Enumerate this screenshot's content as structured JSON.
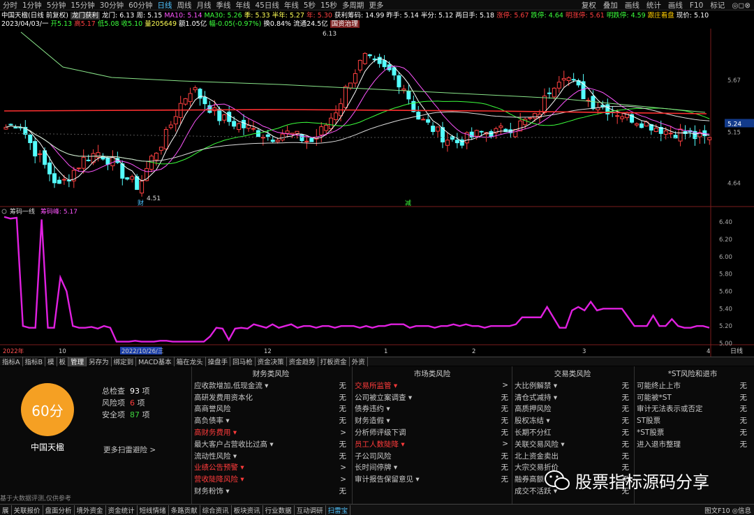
{
  "periods": [
    "分时",
    "1分钟",
    "5分钟",
    "15分钟",
    "30分钟",
    "60分钟",
    "日线",
    "周线",
    "月线",
    "季线",
    "年线",
    "45日线",
    "年线",
    "5秒",
    "15秒",
    "多周期",
    "更多"
  ],
  "active_period_index": 6,
  "top_buttons": [
    "复权",
    "叠加",
    "画线",
    "统计",
    "画线",
    "F10",
    "标记"
  ],
  "top_right_icons": "◎◻⊗",
  "info1": {
    "name": "中国天楹(日线 前复权)",
    "tag": "龙门获利",
    "longmen": "龙门: 6.13",
    "zhou": "周: 5.15",
    "ma10": "MA10: 5.14",
    "ma30": "MA30: 5.26",
    "ji": "季: 5.33",
    "bannian": "半年: 5.27",
    "nian": "年: 5.30",
    "huoli": "获利筹码: 14.99",
    "zuoshou": "昨手: 5.14",
    "banfen": "半分: 5.12",
    "liangri": "两日手: 5.18",
    "zhangting": "涨停: 5.67",
    "dieting": "跌停: 4.64",
    "mingzhang": "明涨停: 5.61",
    "mingdie": "明跌停: 4.59",
    "genzhuang": "跟庄看盘",
    "xianjia": "现价: 5.10"
  },
  "info2": {
    "date": "2023/04/03/一",
    "kai": "开5.13",
    "gao": "高5.17",
    "di": "低5.08",
    "shou": "收5.10",
    "liang": "量205649",
    "e": "额1.05亿",
    "fu": "幅-0.05(-0.97%)",
    "huan": "换0.84%",
    "liutong": "流通24.5亿",
    "badge": "国资治理"
  },
  "price_labels": {
    "high": "6.13",
    "low": "4.51",
    "tag_cai": "财",
    "tag_jian": "减",
    "current": "5.24"
  },
  "price_axis": [
    "5.67",
    "5.15",
    "4.64"
  ],
  "x_axis": [
    "2022年",
    "10",
    "2022/10/26/三",
    "12",
    "1",
    "2",
    "3",
    "4"
  ],
  "sub_header": {
    "name": "筹码一线",
    "value": "筹码峰: 5.17"
  },
  "sub_axis": [
    "6.40",
    "6.20",
    "6.00",
    "5.80",
    "5.60",
    "5.40",
    "5.20",
    "5.00"
  ],
  "corner_label": "日线",
  "chart_data": {
    "type": "line",
    "title": "筹码一线",
    "series": [
      {
        "name": "筹码峰",
        "values": [
          6.46,
          6.44,
          6.45,
          5.2,
          5.18,
          5.18,
          6.43,
          5.18,
          5.18,
          5.76,
          5.6,
          5.2,
          5.18,
          5.18,
          5.19,
          5.17,
          5.2,
          5.18,
          5.02,
          5.02,
          5.02,
          5.03,
          5.02,
          5.02,
          5.02,
          5.03,
          5.03,
          5.02,
          5.02,
          5.02,
          5.02,
          5.02,
          5.02,
          5.08,
          5.18,
          5.17,
          5.04,
          5.17,
          5.18,
          5.17,
          5.22,
          5.2,
          5.18,
          5.22,
          5.18,
          5.2,
          5.22,
          5.18,
          5.2,
          5.2,
          5.18,
          5.2,
          5.2,
          5.18,
          5.2,
          5.2,
          5.2,
          5.18,
          5.2,
          5.18,
          5.2,
          5.2,
          5.22,
          5.22,
          5.22,
          5.18,
          5.2,
          5.2,
          5.2,
          5.18,
          5.2,
          5.2,
          5.22,
          5.2,
          5.22,
          5.2,
          5.2,
          5.18,
          5.2,
          5.2,
          5.2,
          5.2,
          5.22,
          5.3,
          5.3,
          5.3,
          5.3,
          5.42,
          5.3,
          5.18,
          5.18,
          5.38,
          5.42,
          5.38,
          5.48,
          5.38,
          5.4,
          5.4,
          5.4,
          5.4,
          5.3,
          5.2,
          5.2,
          5.2,
          5.32,
          5.2,
          5.2,
          5.28,
          5.2,
          5.18,
          5.18,
          5.2,
          5.2,
          5.18
        ]
      }
    ],
    "ylim": [
      5.0,
      6.45
    ]
  },
  "risk": {
    "score": "60分",
    "company": "中国天楹",
    "total_label": "总检查",
    "total_value": "93",
    "risk_label": "风险项",
    "risk_value": "6",
    "safe_label": "安全项",
    "safe_value": "87",
    "unit": "项",
    "more": "更多扫雷避险 >",
    "footnote": "基于大数据评测,仅供参考",
    "cols": [
      {
        "title": "财务类风险",
        "items": [
          {
            "label": "应收款增加,低现金流 ▾",
            "val": "无",
            "red": false
          },
          {
            "label": "高研发费用资本化",
            "val": "无",
            "red": false
          },
          {
            "label": "高商誉风险",
            "val": "无",
            "red": false
          },
          {
            "label": "高负债率 ▾",
            "val": "无",
            "red": false
          },
          {
            "label": "高财务费用 ▾",
            "val": ">",
            "red": true
          },
          {
            "label": "最大客户占营收比过高 ▾",
            "val": "无",
            "red": false
          },
          {
            "label": "流动性风险 ▾",
            "val": "无",
            "red": false
          },
          {
            "label": "业绩公告预警 ▾",
            "val": ">",
            "red": true
          },
          {
            "label": "营收陡降风险 ▾",
            "val": ">",
            "red": true
          },
          {
            "label": "财务粉饰 ▾",
            "val": "无",
            "red": false
          }
        ]
      },
      {
        "title": "市场类风险",
        "items": [
          {
            "label": "交易所监管 ▾",
            "val": ">",
            "red": true
          },
          {
            "label": "公司被立案调查 ▾",
            "val": "无",
            "red": false
          },
          {
            "label": "债券违约 ▾",
            "val": "无",
            "red": false
          },
          {
            "label": "财务造假 ▾",
            "val": "无",
            "red": false
          },
          {
            "label": "分析师评级下调",
            "val": "无",
            "red": false
          },
          {
            "label": "员工人数陡降 ▾",
            "val": ">",
            "red": true
          },
          {
            "label": "子公司风险",
            "val": "无",
            "red": false
          },
          {
            "label": "长时间停牌 ▾",
            "val": "无",
            "red": false
          },
          {
            "label": "审计报告保留意见 ▾",
            "val": "无",
            "red": false
          }
        ]
      },
      {
        "title": "交易类风险",
        "items": [
          {
            "label": "大比例解禁 ▾",
            "val": "无",
            "red": false
          },
          {
            "label": "清仓式减持 ▾",
            "val": "无",
            "red": false
          },
          {
            "label": "高质押风险",
            "val": "无",
            "red": false
          },
          {
            "label": "股权冻结 ▾",
            "val": "无",
            "red": false
          },
          {
            "label": "长期不分红",
            "val": "无",
            "red": false
          },
          {
            "label": "关联交易风险 ▾",
            "val": "无",
            "red": false
          },
          {
            "label": "北上资金卖出",
            "val": "无",
            "red": false
          },
          {
            "label": "大宗交易折价",
            "val": "无",
            "red": false
          },
          {
            "label": "融券高额",
            "val": "无",
            "red": false
          },
          {
            "label": "成交不活跃 ▾",
            "val": "无",
            "red": false
          }
        ]
      },
      {
        "title": "*ST风险和退市",
        "items": [
          {
            "label": "可能终止上市",
            "val": "无",
            "red": false
          },
          {
            "label": "可能被*ST",
            "val": "无",
            "red": false
          },
          {
            "label": "审计无法表示或否定",
            "val": "无",
            "red": false
          },
          {
            "label": "ST股票",
            "val": "无",
            "red": false
          },
          {
            "label": "*ST股票",
            "val": "无",
            "red": false
          },
          {
            "label": "进入退市整理",
            "val": "无",
            "red": false
          }
        ]
      }
    ]
  },
  "tabs": [
    "指标A",
    "指标B",
    "模",
    "板",
    "管理",
    "另存为",
    "绑定到",
    "MACD基本",
    "箱在龙头",
    "操盘手",
    "回马枪",
    "资金决策",
    "资金趋势",
    "打板资金",
    "外资"
  ],
  "active_tab_index": 4,
  "bottom_tabs": [
    "展",
    "关联报价",
    "盘面分析",
    "境外资金",
    "资金统计",
    "短线情绪",
    "条路贡献",
    "综合资讯",
    "板块资讯",
    "行业数据",
    "互动调研",
    "扫雷宝"
  ],
  "active_bottom_index": 11,
  "bottom_right": "图文F10 ◎信息",
  "watermark": "股票指标源码分享"
}
